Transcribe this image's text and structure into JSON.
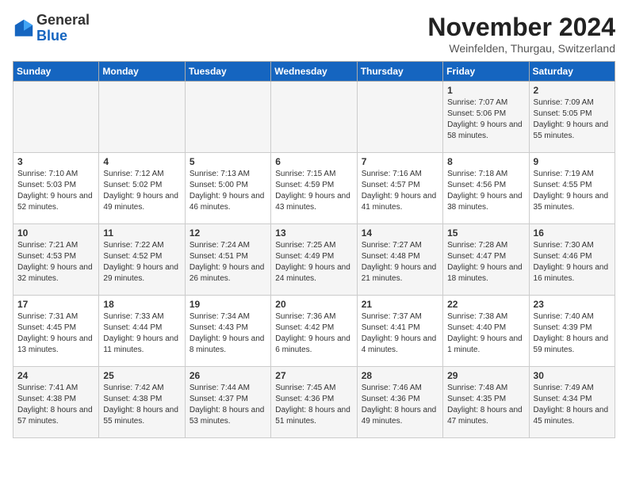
{
  "logo": {
    "general": "General",
    "blue": "Blue"
  },
  "title": "November 2024",
  "location": "Weinfelden, Thurgau, Switzerland",
  "days_of_week": [
    "Sunday",
    "Monday",
    "Tuesday",
    "Wednesday",
    "Thursday",
    "Friday",
    "Saturday"
  ],
  "weeks": [
    [
      {
        "day": "",
        "info": ""
      },
      {
        "day": "",
        "info": ""
      },
      {
        "day": "",
        "info": ""
      },
      {
        "day": "",
        "info": ""
      },
      {
        "day": "",
        "info": ""
      },
      {
        "day": "1",
        "info": "Sunrise: 7:07 AM\nSunset: 5:06 PM\nDaylight: 9 hours and 58 minutes."
      },
      {
        "day": "2",
        "info": "Sunrise: 7:09 AM\nSunset: 5:05 PM\nDaylight: 9 hours and 55 minutes."
      }
    ],
    [
      {
        "day": "3",
        "info": "Sunrise: 7:10 AM\nSunset: 5:03 PM\nDaylight: 9 hours and 52 minutes."
      },
      {
        "day": "4",
        "info": "Sunrise: 7:12 AM\nSunset: 5:02 PM\nDaylight: 9 hours and 49 minutes."
      },
      {
        "day": "5",
        "info": "Sunrise: 7:13 AM\nSunset: 5:00 PM\nDaylight: 9 hours and 46 minutes."
      },
      {
        "day": "6",
        "info": "Sunrise: 7:15 AM\nSunset: 4:59 PM\nDaylight: 9 hours and 43 minutes."
      },
      {
        "day": "7",
        "info": "Sunrise: 7:16 AM\nSunset: 4:57 PM\nDaylight: 9 hours and 41 minutes."
      },
      {
        "day": "8",
        "info": "Sunrise: 7:18 AM\nSunset: 4:56 PM\nDaylight: 9 hours and 38 minutes."
      },
      {
        "day": "9",
        "info": "Sunrise: 7:19 AM\nSunset: 4:55 PM\nDaylight: 9 hours and 35 minutes."
      }
    ],
    [
      {
        "day": "10",
        "info": "Sunrise: 7:21 AM\nSunset: 4:53 PM\nDaylight: 9 hours and 32 minutes."
      },
      {
        "day": "11",
        "info": "Sunrise: 7:22 AM\nSunset: 4:52 PM\nDaylight: 9 hours and 29 minutes."
      },
      {
        "day": "12",
        "info": "Sunrise: 7:24 AM\nSunset: 4:51 PM\nDaylight: 9 hours and 26 minutes."
      },
      {
        "day": "13",
        "info": "Sunrise: 7:25 AM\nSunset: 4:49 PM\nDaylight: 9 hours and 24 minutes."
      },
      {
        "day": "14",
        "info": "Sunrise: 7:27 AM\nSunset: 4:48 PM\nDaylight: 9 hours and 21 minutes."
      },
      {
        "day": "15",
        "info": "Sunrise: 7:28 AM\nSunset: 4:47 PM\nDaylight: 9 hours and 18 minutes."
      },
      {
        "day": "16",
        "info": "Sunrise: 7:30 AM\nSunset: 4:46 PM\nDaylight: 9 hours and 16 minutes."
      }
    ],
    [
      {
        "day": "17",
        "info": "Sunrise: 7:31 AM\nSunset: 4:45 PM\nDaylight: 9 hours and 13 minutes."
      },
      {
        "day": "18",
        "info": "Sunrise: 7:33 AM\nSunset: 4:44 PM\nDaylight: 9 hours and 11 minutes."
      },
      {
        "day": "19",
        "info": "Sunrise: 7:34 AM\nSunset: 4:43 PM\nDaylight: 9 hours and 8 minutes."
      },
      {
        "day": "20",
        "info": "Sunrise: 7:36 AM\nSunset: 4:42 PM\nDaylight: 9 hours and 6 minutes."
      },
      {
        "day": "21",
        "info": "Sunrise: 7:37 AM\nSunset: 4:41 PM\nDaylight: 9 hours and 4 minutes."
      },
      {
        "day": "22",
        "info": "Sunrise: 7:38 AM\nSunset: 4:40 PM\nDaylight: 9 hours and 1 minute."
      },
      {
        "day": "23",
        "info": "Sunrise: 7:40 AM\nSunset: 4:39 PM\nDaylight: 8 hours and 59 minutes."
      }
    ],
    [
      {
        "day": "24",
        "info": "Sunrise: 7:41 AM\nSunset: 4:38 PM\nDaylight: 8 hours and 57 minutes."
      },
      {
        "day": "25",
        "info": "Sunrise: 7:42 AM\nSunset: 4:38 PM\nDaylight: 8 hours and 55 minutes."
      },
      {
        "day": "26",
        "info": "Sunrise: 7:44 AM\nSunset: 4:37 PM\nDaylight: 8 hours and 53 minutes."
      },
      {
        "day": "27",
        "info": "Sunrise: 7:45 AM\nSunset: 4:36 PM\nDaylight: 8 hours and 51 minutes."
      },
      {
        "day": "28",
        "info": "Sunrise: 7:46 AM\nSunset: 4:36 PM\nDaylight: 8 hours and 49 minutes."
      },
      {
        "day": "29",
        "info": "Sunrise: 7:48 AM\nSunset: 4:35 PM\nDaylight: 8 hours and 47 minutes."
      },
      {
        "day": "30",
        "info": "Sunrise: 7:49 AM\nSunset: 4:34 PM\nDaylight: 8 hours and 45 minutes."
      }
    ]
  ]
}
